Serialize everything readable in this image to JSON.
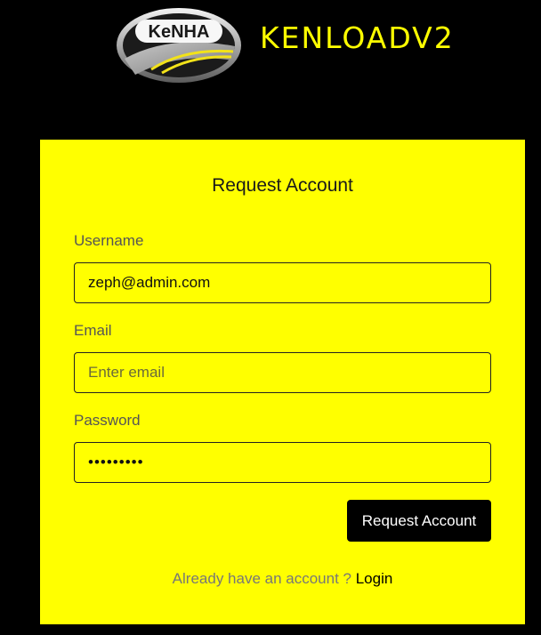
{
  "header": {
    "logo_text": "KeNHA",
    "brand_name": "KENLOADV2"
  },
  "form": {
    "title": "Request Account",
    "username": {
      "label": "Username",
      "value": "zeph@admin.com",
      "placeholder": ""
    },
    "email": {
      "label": "Email",
      "value": "",
      "placeholder": "Enter email"
    },
    "password": {
      "label": "Password",
      "value": "123456789"
    },
    "submit_label": "Request Account",
    "footer_prompt": "Already have an account ? ",
    "login_link": "Login"
  },
  "colors": {
    "background": "#000000",
    "card": "#ffff00",
    "button": "#000000",
    "brand": "#ffff00"
  }
}
